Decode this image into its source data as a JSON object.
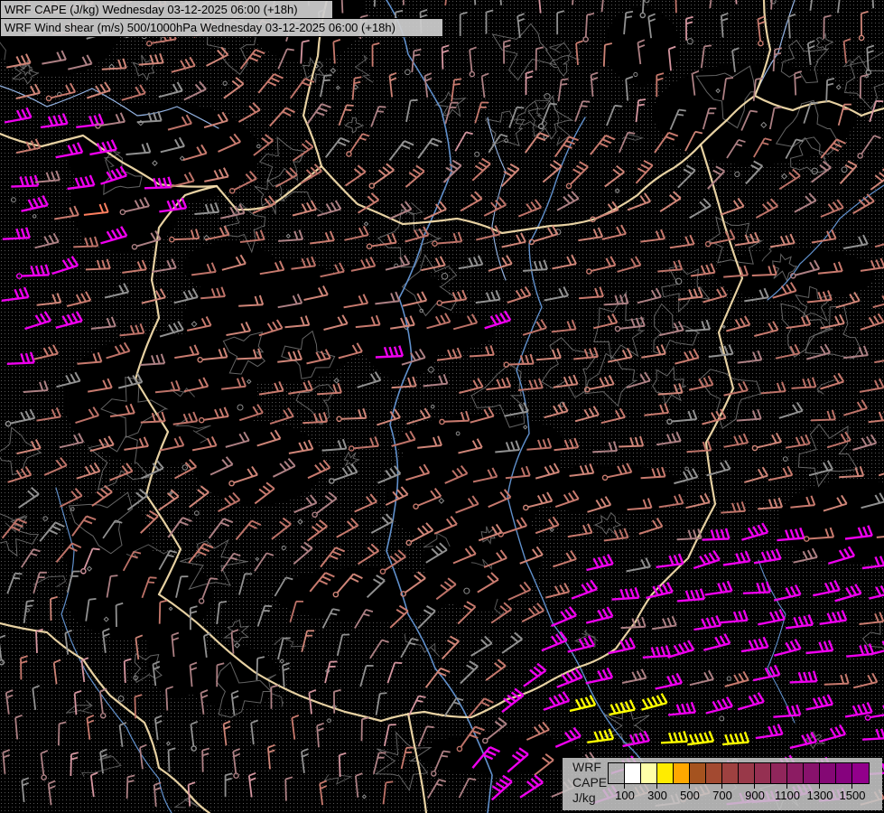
{
  "header": {
    "line1": "WRF CAPE (J/kg) Wednesday 03-12-2025 06:00 (+18h)",
    "line2": "WRF Wind shear (m/s) 500/1000hPa Wednesday 03-12-2025 06:00 (+18h)"
  },
  "legend": {
    "model_label": "WRF",
    "param_label": "CAPE",
    "unit_label": "J/kg",
    "tick_labels": [
      "100",
      "300",
      "500",
      "700",
      "900",
      "1100",
      "1300",
      "1500"
    ],
    "cell_colors": [
      "transparent",
      "#ffffff",
      "#ffffa8",
      "#ffec00",
      "#ffa800",
      "#a5531f",
      "#a34a31",
      "#9e4140",
      "#993949",
      "#953052",
      "#90265b",
      "#8c1c63",
      "#88126c",
      "#840874",
      "#86027e",
      "#92008b"
    ]
  },
  "map": {
    "colors": {
      "background": "#000000",
      "stipple_dot": "#6e6e6e",
      "contour_gray": "#7d7d7d",
      "glyph_gray": "#8d8d8d",
      "border_cream": "#f3dcab",
      "river_blue": "#6090cc",
      "river_light_blue": "#94b4e4",
      "barb_salmon": "#c87a6e",
      "barb_salmon_light": "#cf8578",
      "barb_salmon_dark": "#bd7268",
      "barb_dusty": "#ad8084",
      "barb_gray": "#919191",
      "barb_pink": "#d596a0",
      "barb_magenta": "#ee00ee",
      "barb_yellow": "#ffff00",
      "barb_orange": "#ff7f5f",
      "title_bg": "rgba(205,205,205,0.93)",
      "legend_bg": "rgba(198,198,198,0.88)",
      "text_color": "#000000"
    }
  }
}
